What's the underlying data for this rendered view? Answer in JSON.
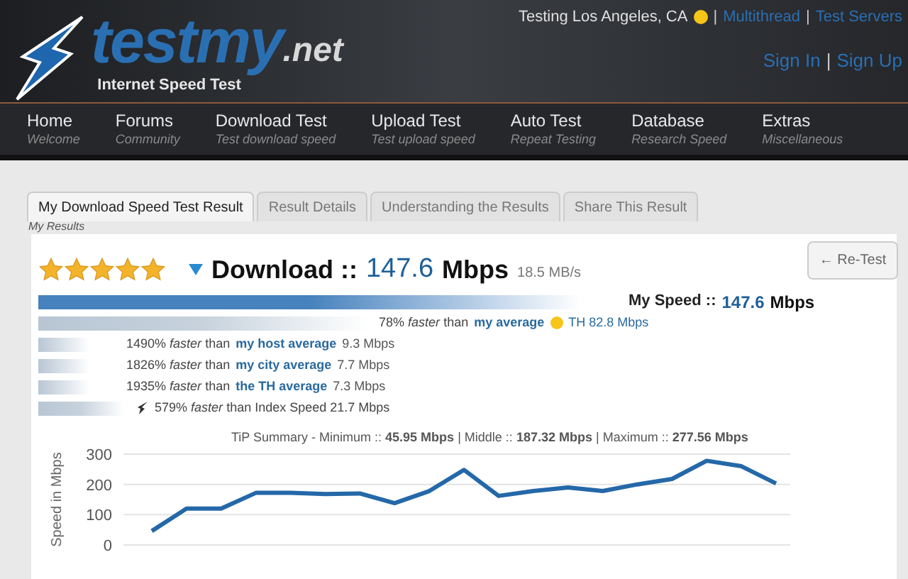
{
  "header": {
    "location": "Testing Los Angeles, CA",
    "separator": "|",
    "links": [
      {
        "label": "Multithread"
      },
      {
        "label": "Test Servers"
      }
    ],
    "account_links": [
      {
        "label": "Sign In"
      },
      {
        "label": "Sign Up"
      }
    ]
  },
  "logo": {
    "name": "testmy",
    "tld": ".net",
    "tagline": "Internet Speed Test"
  },
  "nav": [
    {
      "label": "Home",
      "subtitle": "Welcome"
    },
    {
      "label": "Forums",
      "subtitle": "Community"
    },
    {
      "label": "Download Test",
      "subtitle": "Test download speed"
    },
    {
      "label": "Upload Test",
      "subtitle": "Test upload speed"
    },
    {
      "label": "Auto Test",
      "subtitle": "Repeat Testing"
    },
    {
      "label": "Database",
      "subtitle": "Research Speed"
    },
    {
      "label": "Extras",
      "subtitle": "Miscellaneous"
    }
  ],
  "tabs": [
    {
      "label": "My Download Speed Test Result",
      "selected": true
    },
    {
      "label": "Result Details",
      "selected": false
    },
    {
      "label": "Understanding the Results",
      "selected": false
    },
    {
      "label": "Share This Result",
      "selected": false
    }
  ],
  "section_label": "My Results",
  "result": {
    "stars": 5,
    "title": "Download ::",
    "speed": "147.6",
    "unit": "Mbps",
    "bytes": "18.5 MB/s",
    "retest": "← Re-Test"
  },
  "bars": [
    {
      "kind": "main",
      "label": "My Speed ::",
      "speed": "147.6",
      "unit": "Mbps"
    },
    {
      "kind": "wide",
      "percent": "78%",
      "faster": "faster",
      "than": "than",
      "link": "my average",
      "emoji": true,
      "value": "TH 82.8 Mbps"
    },
    {
      "kind": "narrow",
      "percent": "1490%",
      "faster": "faster",
      "than": "than",
      "link": "my host average",
      "emoji": false,
      "value": "9.3 Mbps"
    },
    {
      "kind": "narrow",
      "percent": "1826%",
      "faster": "faster",
      "than": "than",
      "link": "my city average",
      "emoji": false,
      "value": "7.7 Mbps"
    },
    {
      "kind": "narrow",
      "percent": "1935%",
      "faster": "faster",
      "than": "than",
      "link": "the TH average",
      "emoji": false,
      "value": "7.3 Mbps"
    },
    {
      "kind": "index",
      "percent": "579%",
      "faster": "faster",
      "than": "than Index Speed",
      "value": "21.7 Mbps"
    }
  ],
  "summary": {
    "prefix": "TiP Summary - Minimum ::",
    "min": "45.95 Mbps",
    "middle_label": "| Middle ::",
    "middle": "187.32 Mbps",
    "max_label": "| Maximum ::",
    "max": "277.56 Mbps"
  },
  "chart_data": {
    "type": "line",
    "ylabel": "Speed in Mbps",
    "ylim": [
      0,
      300
    ],
    "yticks": [
      0,
      100,
      200,
      300
    ],
    "series": [
      {
        "color": "#2468a8",
        "values": [
          46,
          120,
          120,
          172,
          172,
          168,
          170,
          138,
          178,
          248,
          162,
          178,
          190,
          178,
          200,
          218,
          278,
          260,
          203
        ]
      }
    ]
  }
}
